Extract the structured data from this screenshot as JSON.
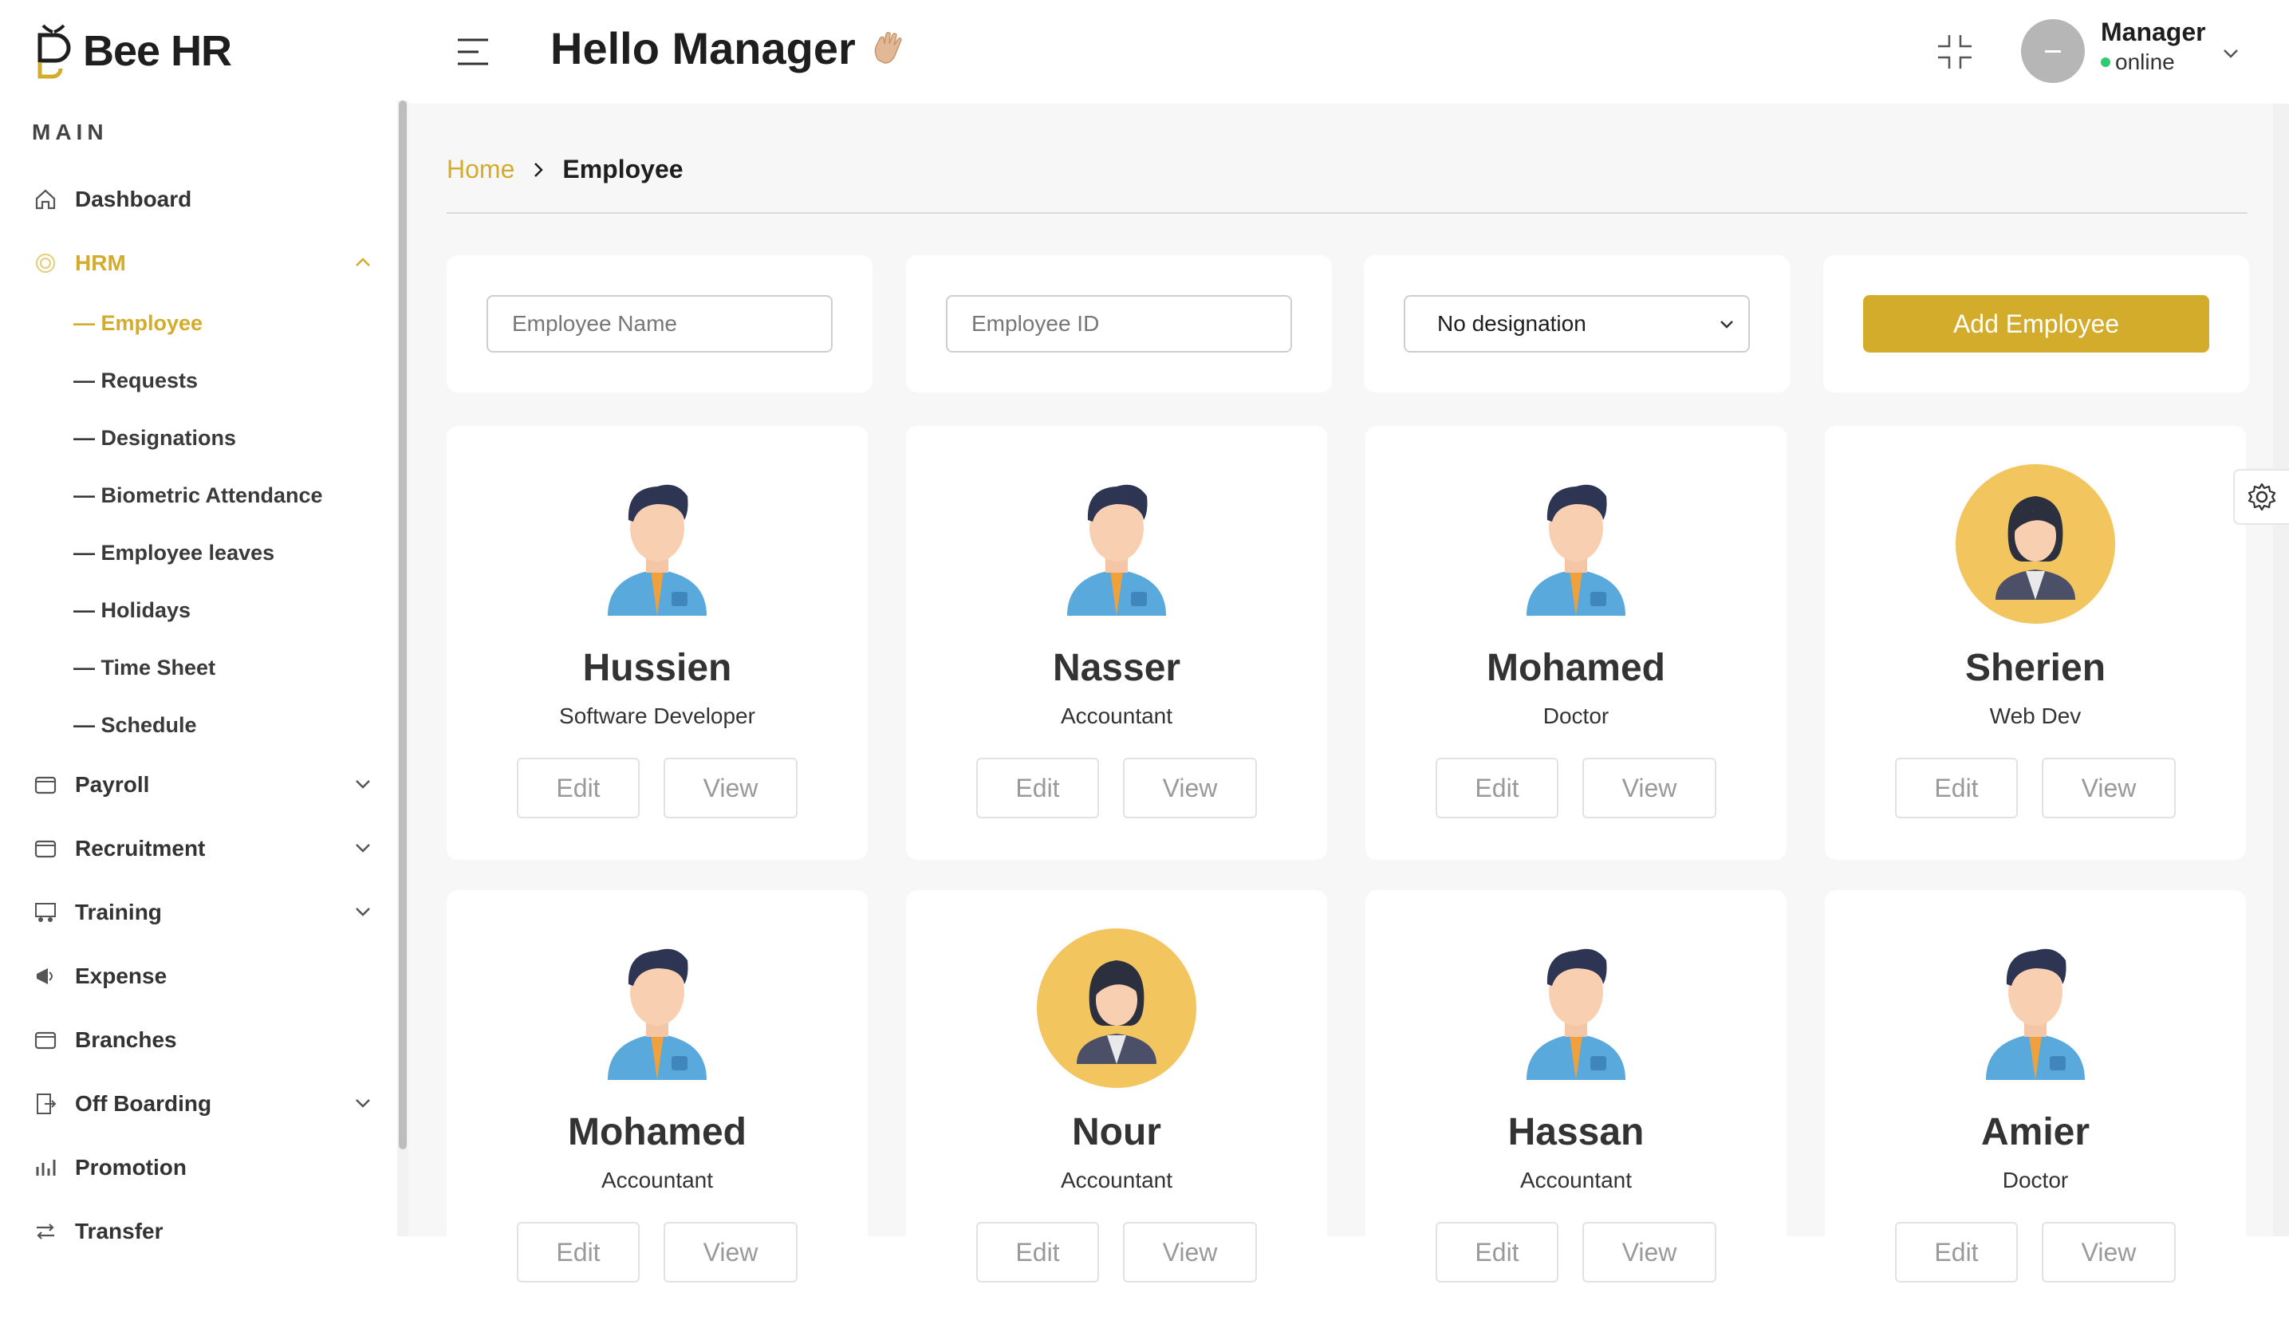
{
  "app": {
    "brand": "Bee HR",
    "brand_text": "BeeHR"
  },
  "sidebar": {
    "section_label": "MAIN",
    "items": [
      {
        "label": "Dashboard",
        "icon": "home-icon"
      },
      {
        "label": "HRM",
        "icon": "target-icon",
        "expanded": true,
        "children": [
          {
            "label": "— Employee",
            "active": true
          },
          {
            "label": "— Requests"
          },
          {
            "label": "— Designations"
          },
          {
            "label": "— Biometric Attendance"
          },
          {
            "label": "— Employee leaves"
          },
          {
            "label": "— Holidays"
          },
          {
            "label": "— Time Sheet"
          },
          {
            "label": "— Schedule"
          }
        ]
      },
      {
        "label": "Payroll",
        "icon": "wallet-icon"
      },
      {
        "label": "Recruitment",
        "icon": "wallet-icon"
      },
      {
        "label": "Training",
        "icon": "training-icon"
      },
      {
        "label": "Expense",
        "icon": "megaphone-icon"
      },
      {
        "label": "Branches",
        "icon": "wallet-icon"
      },
      {
        "label": "Off Boarding",
        "icon": "offboarding-icon"
      },
      {
        "label": "Promotion",
        "icon": "promotion-icon"
      },
      {
        "label": "Transfer",
        "icon": "transfer-icon"
      }
    ]
  },
  "header": {
    "greeting": "Hello Manager",
    "user": {
      "name": "Manager",
      "status": "online"
    }
  },
  "breadcrumb": {
    "home": "Home",
    "current": "Employee"
  },
  "filters": {
    "name_placeholder": "Employee Name",
    "id_placeholder": "Employee ID",
    "designation_selected": "No designation",
    "add_button": "Add Employee"
  },
  "employees": [
    {
      "name": "Hussien",
      "role": "Software Developer",
      "avatar": "male-avatar-icon"
    },
    {
      "name": "Nasser",
      "role": "Accountant",
      "avatar": "male-avatar-icon"
    },
    {
      "name": "Mohamed",
      "role": "Doctor",
      "avatar": "male-avatar-icon"
    },
    {
      "name": "Sherien",
      "role": "Web Dev",
      "avatar": "female-avatar-icon"
    },
    {
      "name": "Mohamed",
      "role": "Accountant",
      "avatar": "male-avatar-icon"
    },
    {
      "name": "Nour",
      "role": "Accountant",
      "avatar": "female-avatar-icon"
    },
    {
      "name": "Hassan",
      "role": "Accountant",
      "avatar": "male-avatar-icon"
    },
    {
      "name": "Amier",
      "role": "Doctor",
      "avatar": "male-avatar-icon"
    }
  ],
  "card_buttons": {
    "edit": "Edit",
    "view": "View"
  },
  "colors": {
    "accent": "#d4ac2c",
    "background": "#f7f7f7",
    "online": "#2ecc71"
  }
}
